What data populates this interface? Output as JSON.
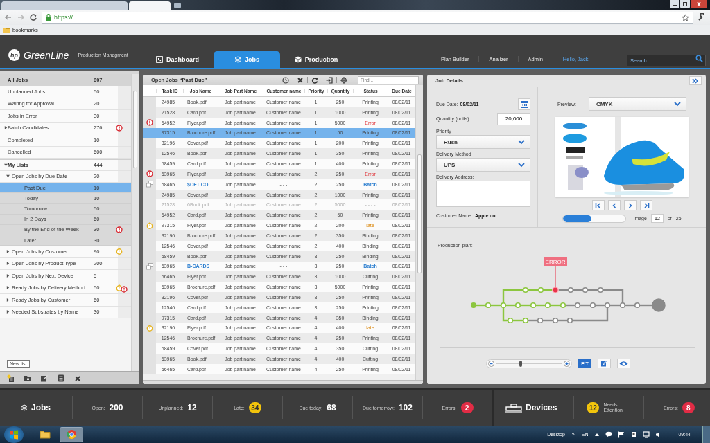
{
  "browser": {
    "tabs": [
      {
        "selected": false
      },
      {
        "selected": true
      }
    ],
    "address": "https://",
    "bookmarks": "bookmarks"
  },
  "header": {
    "logo_mark": "hp",
    "brand": "GreenLine",
    "subtitle": "Production Managment",
    "tabs": [
      {
        "label": "Dashboard",
        "kind": "dashboard",
        "selected": false
      },
      {
        "label": "Jobs",
        "kind": "jobs",
        "selected": true
      },
      {
        "label": "Production",
        "kind": "production",
        "selected": false
      }
    ],
    "links": [
      "Plan Builder",
      "Analizer",
      "Admin"
    ],
    "user": "Hello, Jack",
    "search": {
      "placeholder": "Search"
    }
  },
  "sidebar": {
    "header": {
      "label": "All Jobs",
      "count": "807"
    },
    "items": [
      {
        "label": "Unplanned Jobs",
        "count": "50",
        "selected": false
      },
      {
        "label": "Waiting for Approval",
        "count": "20",
        "selected": false
      },
      {
        "label": "Jobs in Error",
        "count": "30",
        "selected": false
      },
      {
        "label": "Batch Candidates",
        "count": "276",
        "selected": false,
        "expanded": false,
        "kind": "error"
      },
      {
        "label": "Completed",
        "count": "10",
        "selected": false
      },
      {
        "label": "Cancelled",
        "count": "600",
        "selected": false
      },
      {
        "label": "My Lists",
        "count": "444",
        "selected": false,
        "expanded": true,
        "children": [
          {
            "label": "Open Jobs by Due Date",
            "count": "20",
            "selected": false,
            "expanded": true,
            "children": [
              {
                "label": "Past Due",
                "count": "10",
                "selected": true
              },
              {
                "label": "Today",
                "count": "10",
                "selected": false
              },
              {
                "label": "Tomorrow",
                "count": "50",
                "selected": false
              },
              {
                "label": "In 2 Days",
                "count": "60",
                "selected": false
              },
              {
                "label": "By the End of the Week",
                "count": "30",
                "selected": false,
                "kind": "error"
              },
              {
                "label": "Later",
                "count": "30",
                "selected": false
              }
            ]
          },
          {
            "label": "Open Jobs by Customer",
            "count": "90",
            "selected": false,
            "expanded": false,
            "kind": "late"
          },
          {
            "label": "Open Jobs by Product Type",
            "count": "200",
            "selected": false,
            "expanded": false
          },
          {
            "label": "Open Jobs by Next Device",
            "count": "5",
            "selected": false,
            "expanded": false
          },
          {
            "label": "Ready Jobs by Delivery Method",
            "count": "50",
            "selected": false,
            "expanded": false,
            "kind": "late_error"
          },
          {
            "label": "Ready Jobs by Customer",
            "count": "60",
            "selected": false,
            "expanded": false
          },
          {
            "label": "Needed Substrates by Name",
            "count": "30",
            "selected": false,
            "expanded": false
          }
        ]
      }
    ],
    "tooltip": "New list"
  },
  "table": {
    "title": "Open Jobs “Past Due”",
    "find": {
      "placeholder": "Find..."
    },
    "columns": [
      "Task ID",
      "Job Name",
      "Job Part Name",
      "Customer name",
      "Priority",
      "Quantity",
      "Status",
      "Due Date"
    ],
    "rows": [
      {
        "task": "24985",
        "job": "Book.pdf",
        "part": "Job part name",
        "customer": "Customer name",
        "priority": "1",
        "quantity": "250",
        "status": "Printing",
        "due": "08/02/11",
        "kind": "normal",
        "selected": false
      },
      {
        "task": "21528",
        "job": "Card.pdf",
        "part": "Job part name",
        "customer": "Customer name",
        "priority": "1",
        "quantity": "1000",
        "status": "Printing",
        "due": "08/02/11",
        "kind": "normal",
        "selected": false
      },
      {
        "task": "64952",
        "job": "Flyer.pdf",
        "part": "Job part name",
        "customer": "Customer name",
        "priority": "1",
        "quantity": "5000",
        "status": "Error",
        "due": "08/02/11",
        "kind": "error",
        "selected": false
      },
      {
        "task": "97315",
        "job": "Brochure.pdf",
        "part": "Job part name",
        "customer": "Customer name",
        "priority": "1",
        "quantity": "50",
        "status": "Printing",
        "due": "08/02/11",
        "kind": "normal",
        "selected": true
      },
      {
        "task": "32196",
        "job": "Cover.pdf",
        "part": "Job part name",
        "customer": "Customer name",
        "priority": "1",
        "quantity": "200",
        "status": "Printing",
        "due": "08/02/11",
        "kind": "normal",
        "selected": false
      },
      {
        "task": "12546",
        "job": "Book.pdf",
        "part": "Job part name",
        "customer": "Customer name",
        "priority": "1",
        "quantity": "350",
        "status": "Printing",
        "due": "08/02/11",
        "kind": "normal",
        "selected": false
      },
      {
        "task": "58459",
        "job": "Card.pdf",
        "part": "Job part name",
        "customer": "Customer name",
        "priority": "1",
        "quantity": "400",
        "status": "Printing",
        "due": "08/02/11",
        "kind": "normal",
        "selected": false
      },
      {
        "task": "63965",
        "job": "Flyer.pdf",
        "part": "Job part name",
        "customer": "Customer name",
        "priority": "2",
        "quantity": "250",
        "status": "Error",
        "due": "08/02/11",
        "kind": "error",
        "selected": false
      },
      {
        "task": "58465",
        "job": "$OFT CO..",
        "part": "Job part name",
        "customer": "- - -",
        "priority": "2",
        "quantity": "250",
        "status": "Batch",
        "due": "08/02/11",
        "kind": "batch",
        "selected": false
      },
      {
        "task": "24985",
        "job": "Cover.pdf",
        "part": "Job part name",
        "customer": "Customer name",
        "priority": "2",
        "quantity": "1000",
        "status": "Printing",
        "due": "08/02/11",
        "kind": "normal",
        "selected": false
      },
      {
        "task": "21528",
        "job": "6Book.pdf",
        "part": "Job part name",
        "customer": "Customer name",
        "priority": "2",
        "quantity": "5000",
        "status": "- - - -",
        "due": "08/02/11",
        "kind": "disabled",
        "selected": false
      },
      {
        "task": "64952",
        "job": "Card.pdf",
        "part": "Job part name",
        "customer": "Customer name",
        "priority": "2",
        "quantity": "50",
        "status": "Printing",
        "due": "08/02/11",
        "kind": "normal",
        "selected": false
      },
      {
        "task": "97315",
        "job": "Flyer.pdf",
        "part": "Job part name",
        "customer": "Customer name",
        "priority": "2",
        "quantity": "200",
        "status": "late",
        "due": "08/02/11",
        "kind": "late",
        "selected": false
      },
      {
        "task": "32196",
        "job": "Brochure.pdf",
        "part": "Job part name",
        "customer": "Customer name",
        "priority": "2",
        "quantity": "350",
        "status": "Binding",
        "due": "08/02/11",
        "kind": "normal",
        "selected": false
      },
      {
        "task": "12546",
        "job": "Cover.pdf",
        "part": "Job part name",
        "customer": "Customer name",
        "priority": "2",
        "quantity": "400",
        "status": "Binding",
        "due": "08/02/11",
        "kind": "normal",
        "selected": false
      },
      {
        "task": "58459",
        "job": "Book.pdf",
        "part": "Job part name",
        "customer": "Customer name",
        "priority": "3",
        "quantity": "250",
        "status": "Binding",
        "due": "08/02/11",
        "kind": "normal",
        "selected": false
      },
      {
        "task": "63965",
        "job": "B-CARDS",
        "part": "Job part name",
        "customer": "- - -",
        "priority": "3",
        "quantity": "250",
        "status": "Batch",
        "due": "08/02/11",
        "kind": "batch",
        "selected": false
      },
      {
        "task": "56465",
        "job": "Flyer.pdf",
        "part": "Job part name",
        "customer": "Customer name",
        "priority": "3",
        "quantity": "1000",
        "status": "Cutting",
        "due": "08/02/11",
        "kind": "normal",
        "selected": false
      },
      {
        "task": "63965",
        "job": "Brochure.pdf",
        "part": "Job part name",
        "customer": "Customer name",
        "priority": "3",
        "quantity": "5000",
        "status": "Printing",
        "due": "08/02/11",
        "kind": "normal",
        "selected": false
      },
      {
        "task": "32196",
        "job": "Cover.pdf",
        "part": "Job part name",
        "customer": "Customer name",
        "priority": "3",
        "quantity": "250",
        "status": "Printing",
        "due": "08/02/11",
        "kind": "normal",
        "selected": false
      },
      {
        "task": "12546",
        "job": "Card.pdf",
        "part": "Job part name",
        "customer": "Customer name",
        "priority": "3",
        "quantity": "250",
        "status": "Printing",
        "due": "08/02/11",
        "kind": "normal",
        "selected": false
      },
      {
        "task": "97315",
        "job": "Card.pdf",
        "part": "Job part name",
        "customer": "Customer name",
        "priority": "4",
        "quantity": "350",
        "status": "Binding",
        "due": "08/02/11",
        "kind": "normal",
        "selected": false
      },
      {
        "task": "32196",
        "job": "Flyer.pdf",
        "part": "Job part name",
        "customer": "Customer name",
        "priority": "4",
        "quantity": "400",
        "status": "late",
        "due": "08/02/11",
        "kind": "late",
        "selected": false
      },
      {
        "task": "12546",
        "job": "Brochure.pdf",
        "part": "Job part name",
        "customer": "Customer name",
        "priority": "4",
        "quantity": "250",
        "status": "Printing",
        "due": "08/02/11",
        "kind": "normal",
        "selected": false
      },
      {
        "task": "58459",
        "job": "Cover.pdf",
        "part": "Job part name",
        "customer": "Customer name",
        "priority": "4",
        "quantity": "350",
        "status": "Cutting",
        "due": "08/02/11",
        "kind": "normal",
        "selected": false
      },
      {
        "task": "63965",
        "job": "Book.pdf",
        "part": "Job part name",
        "customer": "Customer name",
        "priority": "4",
        "quantity": "400",
        "status": "Cutting",
        "due": "08/02/11",
        "kind": "normal",
        "selected": false
      },
      {
        "task": "56465",
        "job": "Card.pdf",
        "part": "Job part name",
        "customer": "Customer name",
        "priority": "4",
        "quantity": "250",
        "status": "Printing",
        "due": "08/02/11",
        "kind": "normal",
        "selected": false
      }
    ]
  },
  "details": {
    "title": "Job Details",
    "due_label": "Due Date:",
    "due": "08/02/11",
    "quantity_label": "Quantity (units):",
    "quantity": "20,000",
    "priority_label": "Priority",
    "priority": "Rush",
    "delivery_label": "Delivery Method",
    "delivery": "UPS",
    "address_label": "Delivery Address:",
    "customer_label": "Customer Name:",
    "customer": "Apple co.",
    "preview_label": "Preview:",
    "preview": "CMYK",
    "progress": {
      "level": 0.45
    },
    "image_label": "Image",
    "image": "12",
    "of_label": "of",
    "total": "25"
  },
  "plan": {
    "label": "Production plan:",
    "error_label": "ERROR",
    "lines": [
      {
        "nodes": [
          {
            "kind": "done"
          },
          {
            "kind": "done"
          },
          {
            "kind": "done"
          },
          {
            "kind": "done"
          },
          {
            "kind": "done"
          },
          {
            "kind": "done"
          },
          {
            "kind": "done"
          },
          {
            "kind": "todo"
          },
          {
            "kind": "todo"
          },
          {
            "kind": "todo"
          },
          {
            "kind": "todo"
          },
          {
            "kind": "todo"
          },
          {
            "kind": "todo"
          }
        ]
      },
      {
        "nodes": [
          {
            "kind": "done"
          },
          {
            "kind": "done"
          },
          {
            "kind": "error"
          },
          {
            "kind": "todo"
          },
          {
            "kind": "todo"
          },
          {
            "kind": "todo"
          }
        ]
      },
      {
        "nodes": [
          {
            "kind": "done"
          },
          {
            "kind": "done"
          },
          {
            "kind": "todo"
          },
          {
            "kind": "todo"
          },
          {
            "kind": "todo"
          }
        ]
      }
    ],
    "zoom": {
      "level": 0.35
    },
    "fit": "FIT"
  },
  "status": {
    "jobs": {
      "title": "Jobs",
      "stats": [
        {
          "label": "Open:",
          "value": "200",
          "kind": "plain"
        },
        {
          "label": "Unplanned:",
          "value": "12",
          "kind": "plain"
        },
        {
          "label": "Late:",
          "value": "34",
          "kind": "warning"
        },
        {
          "label": "Due today:",
          "value": "68",
          "kind": "plain"
        },
        {
          "label": "Due tomorrow:",
          "value": "102",
          "kind": "plain"
        },
        {
          "label": "Errors:",
          "value": "2",
          "kind": "error"
        }
      ]
    },
    "devices": {
      "title": "Devices",
      "stats": [
        {
          "label": "Needs Ettention",
          "value": "12",
          "kind": "warning_lead"
        },
        {
          "label": "Errors:",
          "value": "8",
          "kind": "error"
        }
      ]
    }
  },
  "taskbar": {
    "items": [
      {
        "kind": "folder",
        "selected": false
      },
      {
        "kind": "browser",
        "selected": true
      }
    ],
    "desktop": "Desktop",
    "chevron": "»",
    "lang": "EN",
    "time": "09:44"
  }
}
